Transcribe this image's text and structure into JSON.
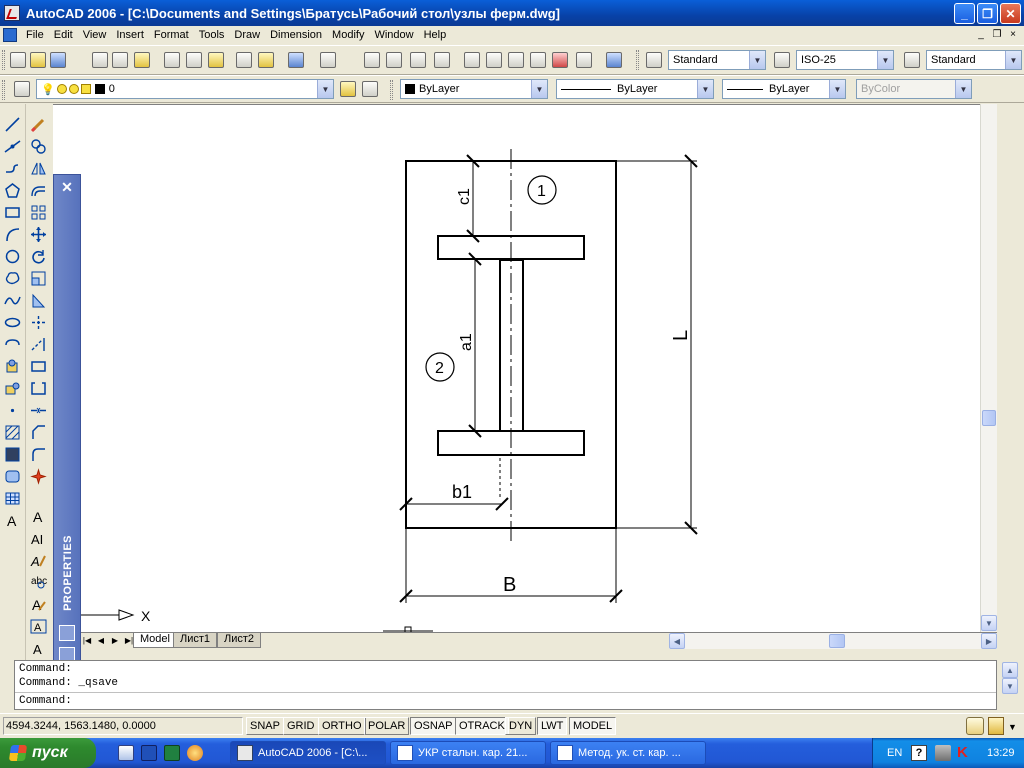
{
  "window": {
    "title": "AutoCAD 2006 - [C:\\Documents and Settings\\Братусь\\Рабочий стол\\узлы ферм.dwg]",
    "min": "_",
    "max": "❐",
    "close": "✕"
  },
  "menu": {
    "items": [
      "File",
      "Edit",
      "View",
      "Insert",
      "Format",
      "Tools",
      "Draw",
      "Dimension",
      "Modify",
      "Window",
      "Help"
    ],
    "doc_min": "_",
    "doc_restore": "❐",
    "doc_close": "×"
  },
  "toolbar1": {
    "text_style": "Standard",
    "dim_style": "ISO-25",
    "table_style": "Standard"
  },
  "toolbar2": {
    "layer": "0",
    "color": "ByLayer",
    "linetype": "ByLayer",
    "lineweight": "ByLayer",
    "plotstyle": "ByColor"
  },
  "drawing": {
    "labels": {
      "c1": "c1",
      "circle1": "1",
      "a1": "a1",
      "circle2": "2",
      "b1": "b1",
      "L": "L",
      "B": "B",
      "x_axis": "X"
    }
  },
  "properties_palette": {
    "title": "PROPERTIES",
    "close": "✕"
  },
  "tabs": {
    "items": [
      "Model",
      "Лист1",
      "Лист2"
    ],
    "active": "Model"
  },
  "command": {
    "lines": [
      "Command:",
      "Command: _qsave",
      "Command:"
    ]
  },
  "status": {
    "coords": "4594.3244, 1563.1480, 0.0000",
    "toggles": [
      {
        "label": "SNAP",
        "on": false
      },
      {
        "label": "GRID",
        "on": false
      },
      {
        "label": "ORTHO",
        "on": false
      },
      {
        "label": "POLAR",
        "on": false
      },
      {
        "label": "OSNAP",
        "on": true
      },
      {
        "label": "OTRACK",
        "on": true
      },
      {
        "label": "DYN",
        "on": false
      },
      {
        "label": "LWT",
        "on": true
      },
      {
        "label": "MODEL",
        "on": true
      }
    ]
  },
  "taskbar": {
    "start": "пуск",
    "tasks": [
      {
        "label": "AutoCAD 2006 - [C:\\...",
        "active": true
      },
      {
        "label": "УКР стальн. кар. 21...",
        "active": false
      },
      {
        "label": "Метод. ук. ст. кар. ...",
        "active": false
      }
    ],
    "lang": "EN",
    "clock": "13:29"
  }
}
